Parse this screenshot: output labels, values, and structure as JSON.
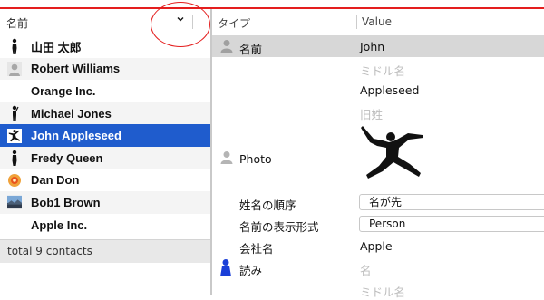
{
  "left_header": {
    "title": "名前"
  },
  "contacts": [
    {
      "name": "山田 太郎",
      "avatar": "person-silhouette-icon",
      "selected": false
    },
    {
      "name": "Robert Williams",
      "avatar": "default-person-icon",
      "selected": false
    },
    {
      "name": "Orange Inc.",
      "avatar": "",
      "selected": false
    },
    {
      "name": "Michael Jones",
      "avatar": "person-silhouette-icon",
      "selected": false
    },
    {
      "name": "John Appleseed",
      "avatar": "jumping-person-icon",
      "selected": true
    },
    {
      "name": "Fredy Queen",
      "avatar": "person-silhouette-icon",
      "selected": false
    },
    {
      "name": "Dan Don",
      "avatar": "flower-icon",
      "selected": false
    },
    {
      "name": "Bob1 Brown",
      "avatar": "landscape-photo-icon",
      "selected": false
    },
    {
      "name": "Apple Inc.",
      "avatar": "",
      "selected": false
    }
  ],
  "footer": {
    "count_text": "total 9 contacts"
  },
  "right_header": {
    "type_label": "タイプ",
    "value_label": "Value"
  },
  "fields": {
    "name_label": "名前",
    "first_name": "John",
    "middle_placeholder": "ミドル名",
    "last_name": "Appleseed",
    "maiden_placeholder": "旧姓",
    "photo_label": "Photo",
    "name_order_label": "姓名の順序",
    "name_order_value": "名が先",
    "display_format_label": "名前の表示形式",
    "display_format_value": "Person",
    "company_label": "会社名",
    "company_value": "Apple",
    "reading_label": "読み",
    "reading_first_placeholder": "名",
    "reading_middle_placeholder": "ミドル名"
  },
  "colors": {
    "selection": "#1f5ccd",
    "annotation": "#e41e1e"
  }
}
